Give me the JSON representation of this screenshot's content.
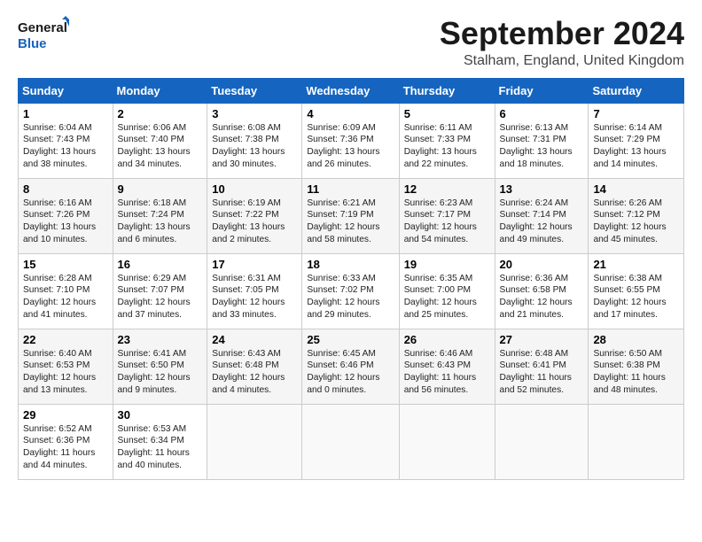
{
  "header": {
    "logo_line1": "General",
    "logo_line2": "Blue",
    "month_title": "September 2024",
    "location": "Stalham, England, United Kingdom"
  },
  "weekdays": [
    "Sunday",
    "Monday",
    "Tuesday",
    "Wednesday",
    "Thursday",
    "Friday",
    "Saturday"
  ],
  "weeks": [
    [
      {
        "day": "1",
        "info": "Sunrise: 6:04 AM\nSunset: 7:43 PM\nDaylight: 13 hours\nand 38 minutes."
      },
      {
        "day": "2",
        "info": "Sunrise: 6:06 AM\nSunset: 7:40 PM\nDaylight: 13 hours\nand 34 minutes."
      },
      {
        "day": "3",
        "info": "Sunrise: 6:08 AM\nSunset: 7:38 PM\nDaylight: 13 hours\nand 30 minutes."
      },
      {
        "day": "4",
        "info": "Sunrise: 6:09 AM\nSunset: 7:36 PM\nDaylight: 13 hours\nand 26 minutes."
      },
      {
        "day": "5",
        "info": "Sunrise: 6:11 AM\nSunset: 7:33 PM\nDaylight: 13 hours\nand 22 minutes."
      },
      {
        "day": "6",
        "info": "Sunrise: 6:13 AM\nSunset: 7:31 PM\nDaylight: 13 hours\nand 18 minutes."
      },
      {
        "day": "7",
        "info": "Sunrise: 6:14 AM\nSunset: 7:29 PM\nDaylight: 13 hours\nand 14 minutes."
      }
    ],
    [
      {
        "day": "8",
        "info": "Sunrise: 6:16 AM\nSunset: 7:26 PM\nDaylight: 13 hours\nand 10 minutes."
      },
      {
        "day": "9",
        "info": "Sunrise: 6:18 AM\nSunset: 7:24 PM\nDaylight: 13 hours\nand 6 minutes."
      },
      {
        "day": "10",
        "info": "Sunrise: 6:19 AM\nSunset: 7:22 PM\nDaylight: 13 hours\nand 2 minutes."
      },
      {
        "day": "11",
        "info": "Sunrise: 6:21 AM\nSunset: 7:19 PM\nDaylight: 12 hours\nand 58 minutes."
      },
      {
        "day": "12",
        "info": "Sunrise: 6:23 AM\nSunset: 7:17 PM\nDaylight: 12 hours\nand 54 minutes."
      },
      {
        "day": "13",
        "info": "Sunrise: 6:24 AM\nSunset: 7:14 PM\nDaylight: 12 hours\nand 49 minutes."
      },
      {
        "day": "14",
        "info": "Sunrise: 6:26 AM\nSunset: 7:12 PM\nDaylight: 12 hours\nand 45 minutes."
      }
    ],
    [
      {
        "day": "15",
        "info": "Sunrise: 6:28 AM\nSunset: 7:10 PM\nDaylight: 12 hours\nand 41 minutes."
      },
      {
        "day": "16",
        "info": "Sunrise: 6:29 AM\nSunset: 7:07 PM\nDaylight: 12 hours\nand 37 minutes."
      },
      {
        "day": "17",
        "info": "Sunrise: 6:31 AM\nSunset: 7:05 PM\nDaylight: 12 hours\nand 33 minutes."
      },
      {
        "day": "18",
        "info": "Sunrise: 6:33 AM\nSunset: 7:02 PM\nDaylight: 12 hours\nand 29 minutes."
      },
      {
        "day": "19",
        "info": "Sunrise: 6:35 AM\nSunset: 7:00 PM\nDaylight: 12 hours\nand 25 minutes."
      },
      {
        "day": "20",
        "info": "Sunrise: 6:36 AM\nSunset: 6:58 PM\nDaylight: 12 hours\nand 21 minutes."
      },
      {
        "day": "21",
        "info": "Sunrise: 6:38 AM\nSunset: 6:55 PM\nDaylight: 12 hours\nand 17 minutes."
      }
    ],
    [
      {
        "day": "22",
        "info": "Sunrise: 6:40 AM\nSunset: 6:53 PM\nDaylight: 12 hours\nand 13 minutes."
      },
      {
        "day": "23",
        "info": "Sunrise: 6:41 AM\nSunset: 6:50 PM\nDaylight: 12 hours\nand 9 minutes."
      },
      {
        "day": "24",
        "info": "Sunrise: 6:43 AM\nSunset: 6:48 PM\nDaylight: 12 hours\nand 4 minutes."
      },
      {
        "day": "25",
        "info": "Sunrise: 6:45 AM\nSunset: 6:46 PM\nDaylight: 12 hours\nand 0 minutes."
      },
      {
        "day": "26",
        "info": "Sunrise: 6:46 AM\nSunset: 6:43 PM\nDaylight: 11 hours\nand 56 minutes."
      },
      {
        "day": "27",
        "info": "Sunrise: 6:48 AM\nSunset: 6:41 PM\nDaylight: 11 hours\nand 52 minutes."
      },
      {
        "day": "28",
        "info": "Sunrise: 6:50 AM\nSunset: 6:38 PM\nDaylight: 11 hours\nand 48 minutes."
      }
    ],
    [
      {
        "day": "29",
        "info": "Sunrise: 6:52 AM\nSunset: 6:36 PM\nDaylight: 11 hours\nand 44 minutes."
      },
      {
        "day": "30",
        "info": "Sunrise: 6:53 AM\nSunset: 6:34 PM\nDaylight: 11 hours\nand 40 minutes."
      },
      {
        "day": "",
        "info": ""
      },
      {
        "day": "",
        "info": ""
      },
      {
        "day": "",
        "info": ""
      },
      {
        "day": "",
        "info": ""
      },
      {
        "day": "",
        "info": ""
      }
    ]
  ]
}
